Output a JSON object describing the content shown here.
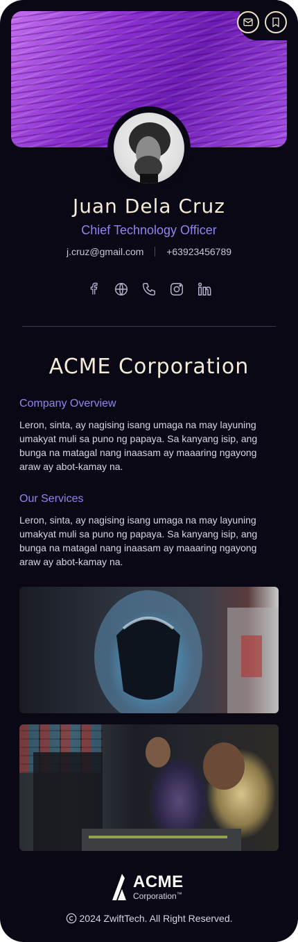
{
  "header": {
    "email_button_icon": "mail-icon",
    "bookmark_button_icon": "bookmark-icon"
  },
  "profile": {
    "name": "Juan Dela Cruz",
    "title": "Chief Technology Officer",
    "email": "j.cruz@gmail.com",
    "phone": "+63923456789",
    "socials": [
      "facebook-icon",
      "globe-icon",
      "phone-icon",
      "instagram-icon",
      "linkedin-icon"
    ]
  },
  "company": {
    "name": "ACME Corporation",
    "overview_heading": "Company Overview",
    "overview_text": "Leron, sinta, ay nagising isang umaga na may layuning umakyat muli sa puno ng papaya. Sa kanyang isip, ang bunga na matagal nang inaasam ay maaaring ngayong araw ay abot-kamay na.",
    "services_heading": "Our Services",
    "services_text": "Leron, sinta, ay nagising isang umaga na may layuning umakyat muli sa puno ng papaya. Sa kanyang isip, ang bunga na matagal nang inaasam ay maaaring ngayong araw ay abot-kamay na."
  },
  "footer": {
    "logo_main": "ACME",
    "logo_sub": "Corporation",
    "logo_tm": "™",
    "copyright": "2024 ZwiftTech. All Right Reserved."
  },
  "colors": {
    "background": "#0b0816",
    "accent": "#8f86f0",
    "cream": "#f4ecd6"
  }
}
